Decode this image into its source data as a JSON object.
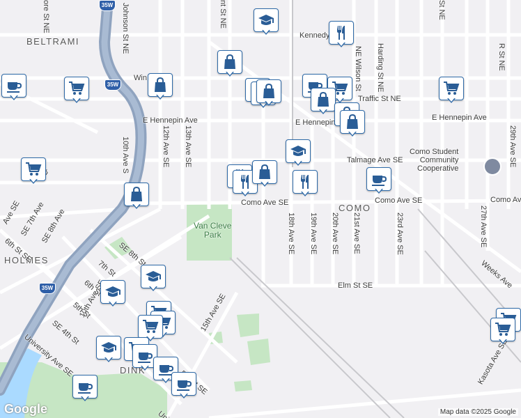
{
  "map": {
    "neighborhoods": {
      "beltrami": "BELTRAMI",
      "holmes": "HOLMES",
      "como": "COMO",
      "dinkytown": "DINK"
    },
    "park": {
      "name_line1": "Van Cleve",
      "name_line2": "Park"
    },
    "streets": {
      "kennedy": "Kennedy",
      "winter": "Win",
      "traffic": "Traffic St NE",
      "e_hennepin_w": "E Hennepin Ave",
      "e_hennepin_c": "E Hennepin",
      "e_hennepin_e": "E Hennepin Ave",
      "talmage": "Talmage Ave SE",
      "como_w": "Como Ave SE",
      "como_e": "Como Ave SE",
      "como_far": "Como Ave",
      "elm": "Elm St SE",
      "johnson": "Johnson St NE",
      "tenth_ave": "10th Ave S",
      "twelfth": "12th Ave SE",
      "thirteenth": "13th Ave SE",
      "fifteenth": "15th Ave SE",
      "eighteenth": "18th Ave SE",
      "nineteenth": "19th Ave SE",
      "twentieth": "20th Ave SE",
      "twentyfirst": "21st Ave SE",
      "twentythird": "23rd Ave SE",
      "twentyseventh": "27th Ave SE",
      "wilson": "NE Wilson St",
      "harding": "Harding St NE",
      "r_st": "R St NE",
      "weeks": "Weeks Ave",
      "kasota": "Kasota Ave SE",
      "university": "University Ave SE",
      "university2": "Uni",
      "se_4th": "SE 4th St",
      "fifth_st": "5th St",
      "fifth_st2": "5th St SE",
      "sixth_st": "6th St",
      "sixth_st_se": "6th St SE",
      "seventh_st": "7th St",
      "se_eighth": "SE 8th St",
      "ninth": "9th St",
      "se7th_ave": "SE 7th Ave",
      "se8th_ave": "SE 8th Ave",
      "tenth_ave_se": "10th Ave SE",
      "ave_se_frag": "Ave SE",
      "nore_st": "ore St NE",
      "nt_st": "nt St NE",
      "st_ne_frag": "St NE",
      "frag27": "27th Ave SE",
      "frag29": "29th Ave SE",
      "frag_9th": "9th",
      "frag_ave": "h Ave"
    },
    "shields": {
      "i35w_a": "35W",
      "i35w_b": "35W",
      "i35w_c": "35W"
    },
    "poi": {
      "como_coop_l1": "Como Student",
      "como_coop_l2": "Community",
      "como_coop_l3": "Cooperative"
    },
    "attribution": "Map data ©2025 Google",
    "logo": "Google",
    "markers": [
      {
        "icon": "school-icon"
      },
      {
        "icon": "restaurant-icon"
      },
      {
        "icon": "shopping-bag-icon"
      },
      {
        "icon": "cafe-icon"
      },
      {
        "icon": "grocery-cart-icon"
      },
      {
        "icon": "shopping-bag-icon"
      },
      {
        "icon": "shopping-bag-icon"
      },
      {
        "icon": "shopping-bag-icon"
      },
      {
        "icon": "shopping-bag-icon"
      },
      {
        "icon": "cafe-icon"
      },
      {
        "icon": "grocery-cart-icon"
      },
      {
        "icon": "shopping-bag-icon"
      },
      {
        "icon": "shopping-bag-icon"
      },
      {
        "icon": "shopping-bag-icon"
      },
      {
        "icon": "grocery-cart-icon"
      },
      {
        "icon": "school-icon"
      },
      {
        "icon": "restaurant-icon"
      },
      {
        "icon": "restaurant-icon"
      },
      {
        "icon": "shopping-bag-icon"
      },
      {
        "icon": "restaurant-icon"
      },
      {
        "icon": "cafe-icon"
      },
      {
        "icon": "grocery-cart-icon"
      },
      {
        "icon": "shopping-bag-icon"
      },
      {
        "icon": "school-icon"
      },
      {
        "icon": "school-icon"
      },
      {
        "icon": "grocery-cart-icon"
      },
      {
        "icon": "grocery-cart-icon"
      },
      {
        "icon": "grocery-cart-icon"
      },
      {
        "icon": "school-icon"
      },
      {
        "icon": "grocery-cart-icon"
      },
      {
        "icon": "cafe-icon"
      },
      {
        "icon": "cafe-icon"
      },
      {
        "icon": "cafe-icon"
      },
      {
        "icon": "cafe-icon"
      },
      {
        "icon": "grocery-cart-icon"
      },
      {
        "icon": "grocery-cart-icon"
      }
    ],
    "colors": {
      "marker_border": "#2f6aa8",
      "highway": "#8fa3bf",
      "park": "#c6e6c4",
      "water": "#aadaff"
    }
  }
}
